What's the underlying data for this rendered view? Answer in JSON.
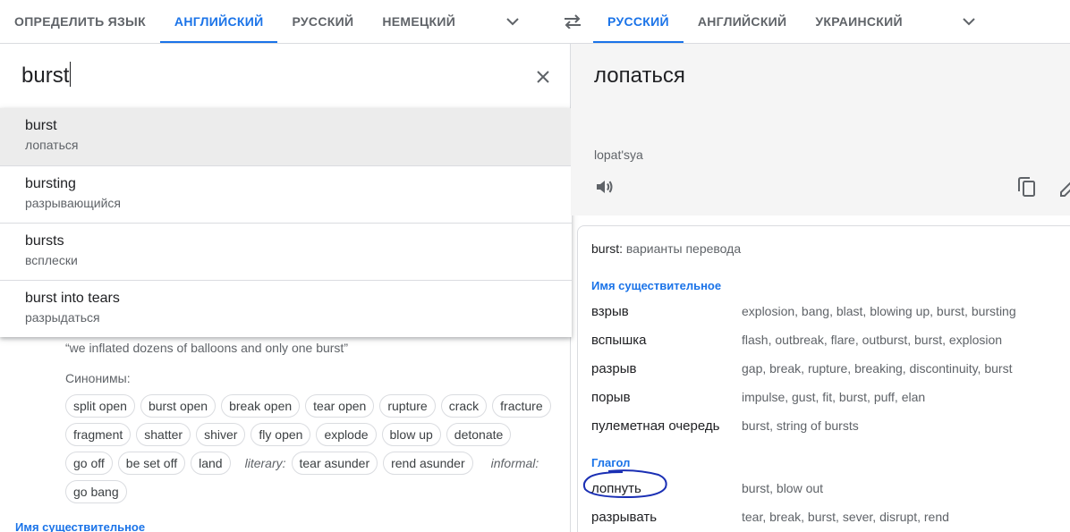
{
  "source_langs": {
    "tabs": [
      "ОПРЕДЕЛИТЬ ЯЗЫК",
      "АНГЛИЙСКИЙ",
      "РУССКИЙ",
      "НЕМЕЦКИЙ"
    ],
    "active_index": 1
  },
  "target_langs": {
    "tabs": [
      "РУССКИЙ",
      "АНГЛИЙСКИЙ",
      "УКРАИНСКИЙ"
    ],
    "active_index": 0
  },
  "icons": {
    "more_langs": "chevron-down-icon",
    "swap": "swap-arrows-icon",
    "clear": "close-icon",
    "speak": "speaker-icon",
    "copy": "copy-icon",
    "edit": "pencil-icon"
  },
  "source": {
    "text": "burst"
  },
  "suggestions": [
    {
      "word": "burst",
      "translation": "лопаться"
    },
    {
      "word": "bursting",
      "translation": "разрывающийся"
    },
    {
      "word": "bursts",
      "translation": "всплески"
    },
    {
      "word": "burst into tears",
      "translation": "разрыдаться"
    }
  ],
  "definition": {
    "example": "“we inflated dozens of balloons and only one burst”",
    "synonyms_label": "Синонимы:",
    "synonym_rows": [
      [
        "split open",
        "burst open",
        "break open",
        "tear open",
        "rupture",
        "crack",
        "fracture"
      ],
      [
        "fragment",
        "shatter",
        "shiver",
        "fly open",
        "explode",
        "blow up",
        "detonate"
      ],
      [
        "go off",
        "be set off",
        "land",
        "literary:",
        "tear asunder",
        "rend asunder",
        "informal:"
      ],
      [
        "go bang"
      ]
    ],
    "register_labels": [
      "literary:",
      "informal:"
    ],
    "next_pos_label": "Имя существительное"
  },
  "result": {
    "text": "лопаться",
    "transliteration": "lopat'sya"
  },
  "dictionary": {
    "header_word": "burst:",
    "header_rest": "варианты перевода",
    "noun_label": "Имя существительное",
    "nouns": [
      {
        "word": "взрыв",
        "synonyms": "explosion, bang, blast, blowing up, burst, bursting"
      },
      {
        "word": "вспышка",
        "synonyms": "flash, outbreak, flare, outburst, burst, explosion"
      },
      {
        "word": "разрыв",
        "synonyms": "gap, break, rupture, breaking, discontinuity, burst"
      },
      {
        "word": "порыв",
        "synonyms": "impulse, gust, fit, burst, puff, elan"
      },
      {
        "word": "пулеметная очередь",
        "synonyms": "burst, string of bursts"
      }
    ],
    "verb_label": "Глагол",
    "verbs": [
      {
        "word": "лопнуть",
        "synonyms": "burst, blow out"
      },
      {
        "word": "разрывать",
        "synonyms": "tear, break, burst, sever, disrupt, rend"
      }
    ],
    "annotation_color": "#1a2fb4"
  },
  "colors": {
    "accent": "#1a73e8",
    "result_bg": "#f5f5f5",
    "highlight_row": "#ececec"
  }
}
